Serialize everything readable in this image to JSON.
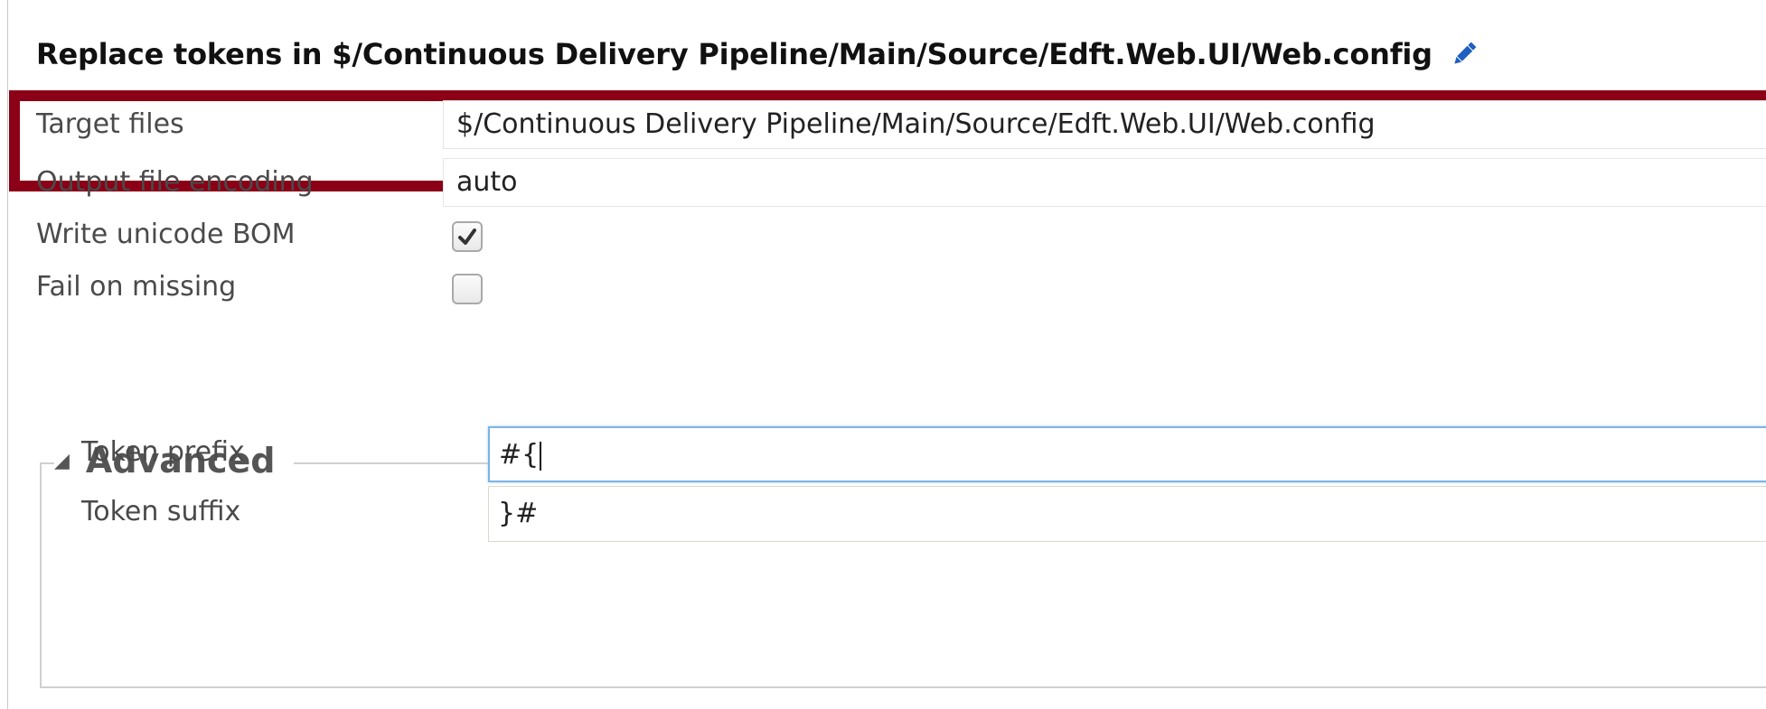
{
  "header": {
    "title": "Replace tokens in $/Continuous Delivery Pipeline/Main/Source/Edft.Web.UI/Web.config",
    "edit_icon": "pencil-icon",
    "accent_color": "#1f5fbf"
  },
  "highlight": {
    "border_color": "#8b0016"
  },
  "fields": {
    "target_files": {
      "label": "Target files",
      "value": "$/Continuous Delivery Pipeline/Main/Source/Edft.Web.UI/Web.config"
    },
    "output_encoding": {
      "label": "Output file encoding",
      "value": "auto"
    },
    "write_bom": {
      "label": "Write unicode BOM",
      "checked": true
    },
    "fail_on_missing": {
      "label": "Fail on missing",
      "checked": false
    }
  },
  "advanced": {
    "legend": "Advanced",
    "collapse_icon": "triangle-down-icon",
    "token_prefix": {
      "label": "Token prefix",
      "value": "#{"
    },
    "token_suffix": {
      "label": "Token suffix",
      "value": "}#"
    }
  }
}
